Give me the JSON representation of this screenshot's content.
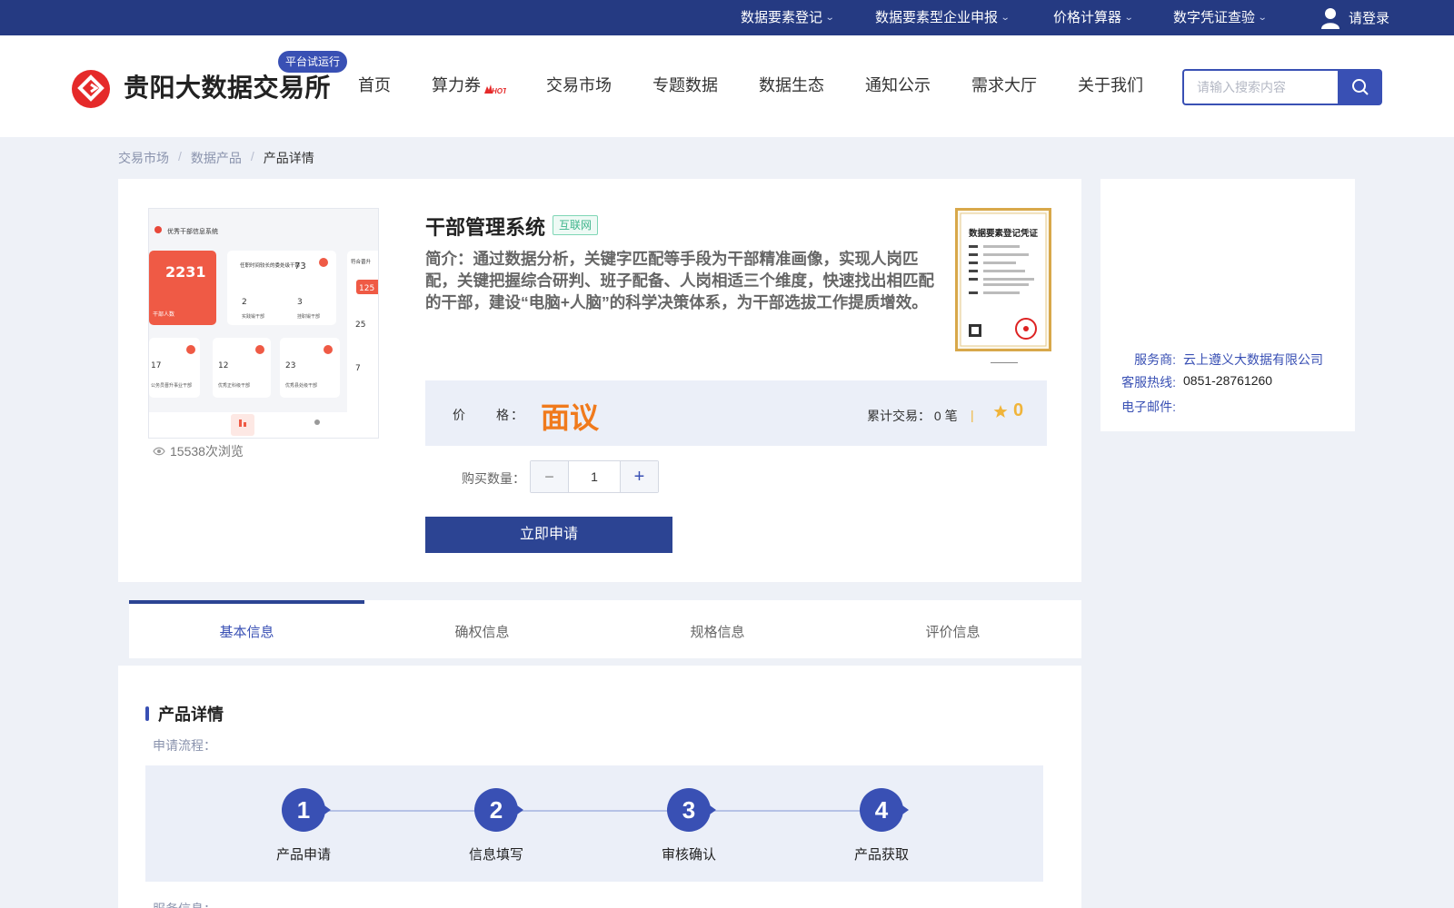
{
  "topbar": {
    "items": [
      {
        "label": "数据要素登记"
      },
      {
        "label": "数据要素型企业申报"
      },
      {
        "label": "价格计算器"
      },
      {
        "label": "数字凭证查验"
      }
    ],
    "login_label": "请登录"
  },
  "header": {
    "logo_text": "贵阳大数据交易所",
    "trial_badge": "平台试运行",
    "nav": [
      {
        "label": "首页"
      },
      {
        "label": "算力券"
      },
      {
        "label": "交易市场"
      },
      {
        "label": "专题数据"
      },
      {
        "label": "数据生态"
      },
      {
        "label": "通知公示"
      },
      {
        "label": "需求大厅"
      },
      {
        "label": "关于我们"
      }
    ],
    "hot_badge": "HOT",
    "search_placeholder": "请输入搜索内容"
  },
  "breadcrumb": {
    "items": [
      "交易市场",
      "数据产品",
      "产品详情"
    ],
    "separator": "/"
  },
  "product": {
    "title": "干部管理系统",
    "tag": "互联网",
    "intro": "简介：通过数据分析，关键字匹配等手段为干部精准画像，实现人岗匹配，关键把握综合研判、班子配备、人岗相适三个维度，快速找出相匹配的干部，建设“电脑+人脑”的科学决策体系，为干部选拔工作提质增效。",
    "views": "15538次浏览",
    "price_label": "价　　格：",
    "price_value": "面议",
    "trade_label": "累计交易：",
    "trade_value": "0 笔",
    "rating_value": "0",
    "qty_label": "购买数量：",
    "qty_value": "1",
    "apply_label": "立即申请",
    "cert_title": "数据要素登记凭证",
    "thumb": {
      "title": "优秀干部信息系统",
      "big_number": "2231",
      "big_label": "干部人数",
      "card_a_title": "任职时间较长的委处级干部",
      "card_a_value": "73",
      "card_b_num1": "2",
      "card_b_label1": "实践锻干部",
      "card_b_num2": "3",
      "card_b_label2": "挂职锻干部",
      "side_title": "符合晋升",
      "side_value": "125",
      "side_num1": "25",
      "side_num2": "7",
      "row": [
        {
          "value": "17",
          "label": "公务员晋升事业干部"
        },
        {
          "value": "12",
          "label": "优秀正科级干部"
        },
        {
          "value": "23",
          "label": "优秀县处级干部"
        }
      ]
    }
  },
  "provider": {
    "service_key": "服务商:",
    "service_value": "云上遵义大数据有限公司",
    "hotline_key": "客服热线:",
    "hotline_value": "0851-28761260",
    "email_key": "电子邮件:",
    "email_value": ""
  },
  "tabs": [
    {
      "label": "基本信息"
    },
    {
      "label": "确权信息"
    },
    {
      "label": "规格信息"
    },
    {
      "label": "评价信息"
    }
  ],
  "detail": {
    "title": "产品详情",
    "flow_label": "申请流程：",
    "steps": [
      {
        "num": "1",
        "label": "产品申请"
      },
      {
        "num": "2",
        "label": "信息填写"
      },
      {
        "num": "3",
        "label": "审核确认"
      },
      {
        "num": "4",
        "label": "产品获取"
      }
    ],
    "service_label": "服务信息："
  },
  "colors": {
    "brand_blue": "#253a82",
    "accent_blue": "#3950b4",
    "price_orange": "#f07a1c",
    "logo_red": "#e52a2a"
  }
}
